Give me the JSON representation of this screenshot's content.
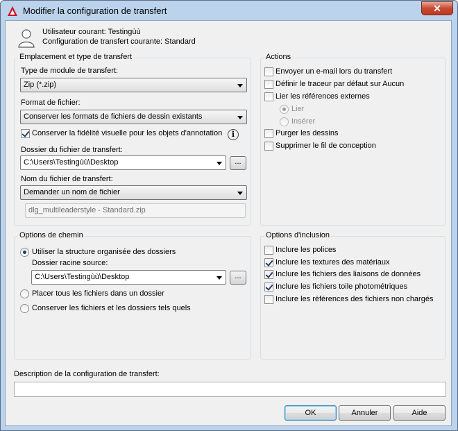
{
  "window": {
    "title": "Modifier la configuration de transfert",
    "close_label": "✕"
  },
  "header": {
    "current_user": "Utilisateur courant: Testingùù",
    "current_config": "Configuration de transfert courante: Standard"
  },
  "location": {
    "group_title": "Emplacement et type de transfert",
    "module_type_label": "Type de module de transfert:",
    "module_type_value": "Zip (*.zip)",
    "file_format_label": "Format de fichier:",
    "file_format_value": "Conserver les formats de fichiers de dessin existants",
    "keep_visual_fidelity_label": "Conserver la fidélité visuelle pour les objets d'annotation",
    "keep_visual_fidelity_checked": true,
    "folder_label": "Dossier du fichier de transfert:",
    "folder_value": "C:\\Users\\Testingùù\\Desktop",
    "browse_label": "...",
    "filename_label": "Nom du fichier de transfert:",
    "filename_value": "Demander un nom de fichier",
    "filename_preview": "dlg_multileaderstyle - Standard.zip"
  },
  "actions": {
    "group_title": "Actions",
    "items": [
      {
        "label": "Envoyer un e-mail lors du transfert",
        "checked": false
      },
      {
        "label": "Définir le traceur par défaut sur Aucun",
        "checked": false
      },
      {
        "label": "Lier les références externes",
        "checked": false
      },
      {
        "label": "Purger les dessins",
        "checked": false
      },
      {
        "label": "Supprimer le fil de conception",
        "checked": false
      }
    ],
    "xref_options": [
      {
        "label": "Lier",
        "checked": true
      },
      {
        "label": "Insérer",
        "checked": false
      }
    ]
  },
  "path_options": {
    "group_title": "Options de chemin",
    "option_organized": "Utiliser la structure organisée des dossiers",
    "root_folder_label": "Dossier racine source:",
    "root_folder_value": "C:\\Users\\Testingùù\\Desktop",
    "browse_label": "...",
    "option_single_folder": "Placer tous les fichiers dans un dossier",
    "option_keep_as_is": "Conserver les fichiers et les dossiers tels quels",
    "selected": "organized"
  },
  "include_options": {
    "group_title": "Options d'inclusion",
    "items": [
      {
        "label": "Inclure les polices",
        "checked": false
      },
      {
        "label": "Inclure les textures des matériaux",
        "checked": true
      },
      {
        "label": "Inclure les fichiers des liaisons de données",
        "checked": true
      },
      {
        "label": "Inclure les fichiers toile photométriques",
        "checked": true
      },
      {
        "label": "Inclure les références des fichiers non chargés",
        "checked": false
      }
    ]
  },
  "description": {
    "label": "Description de la configuration de transfert:",
    "value": ""
  },
  "buttons": {
    "ok": "OK",
    "cancel": "Annuler",
    "help": "Aide"
  },
  "colors": {
    "title_bar": "#bcd3ec",
    "dialog_bg": "#f0f0f0",
    "app_icon_red": "#d0102a"
  }
}
